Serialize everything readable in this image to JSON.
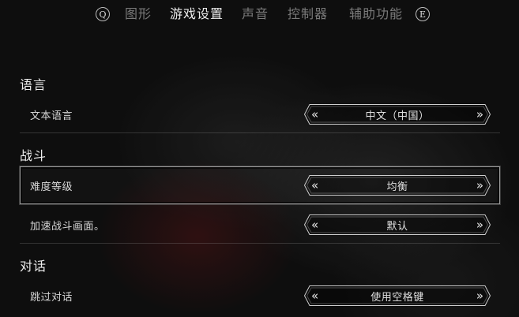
{
  "tabs": {
    "prev_key": "Q",
    "next_key": "E",
    "items": [
      {
        "label": "图形",
        "active": false
      },
      {
        "label": "游戏设置",
        "active": true
      },
      {
        "label": "声音",
        "active": false
      },
      {
        "label": "控制器",
        "active": false
      },
      {
        "label": "辅助功能",
        "active": false
      }
    ]
  },
  "sections": [
    {
      "title": "语言",
      "rows": [
        {
          "label": "文本语言",
          "value": "中文（中国）",
          "selected": false
        }
      ]
    },
    {
      "title": "战斗",
      "rows": [
        {
          "label": "难度等级",
          "value": "均衡",
          "selected": true
        },
        {
          "label": "加速战斗画面。",
          "value": "默认",
          "selected": false
        }
      ]
    },
    {
      "title": "对话",
      "rows": [
        {
          "label": "跳过对话",
          "value": "使用空格键",
          "selected": false
        }
      ]
    }
  ],
  "selector_arrows": {
    "left": "«",
    "right": "»"
  },
  "colors": {
    "active_tab": "#ebebeb",
    "inactive_tab": "#7a7a7a",
    "background": "#121212"
  }
}
